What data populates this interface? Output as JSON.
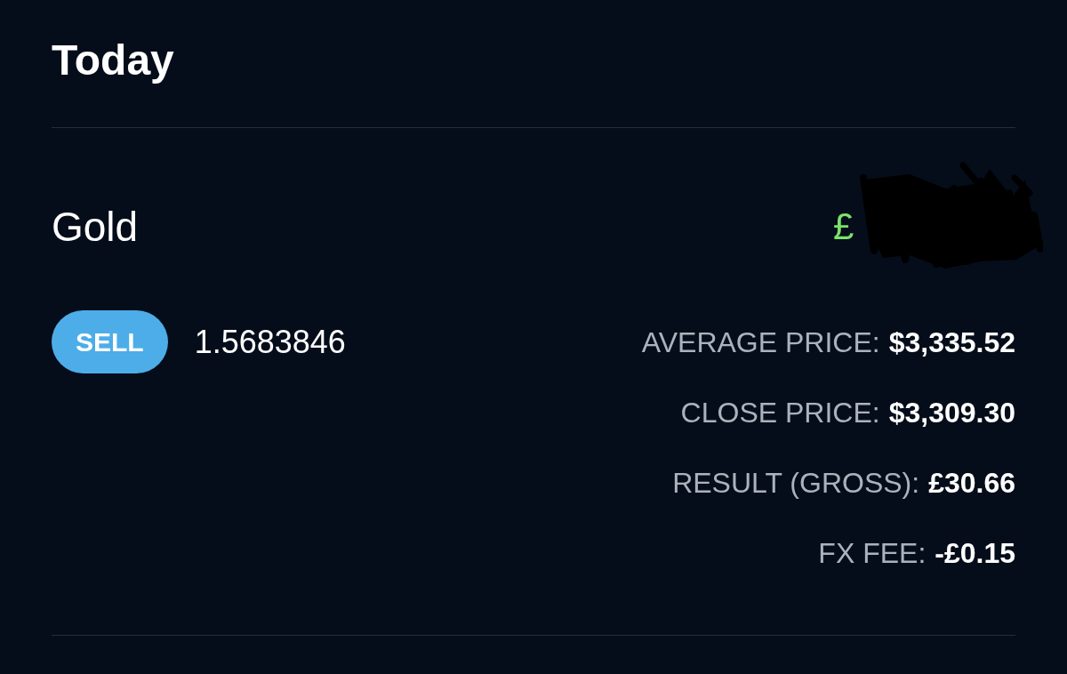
{
  "header": {
    "title": "Today"
  },
  "trade": {
    "instrument": "Gold",
    "amount": "£",
    "amount_positive": true,
    "amount_redacted": true,
    "side": {
      "label": "SELL",
      "kind": "sell"
    },
    "quantity": "1.5683846",
    "details": [
      {
        "label": "AVERAGE PRICE:",
        "value": "$3,335.52"
      },
      {
        "label": "CLOSE PRICE:",
        "value": "$3,309.30"
      },
      {
        "label": "RESULT (GROSS):",
        "value": "£30.66"
      },
      {
        "label": "FX FEE:",
        "value": "-£0.15"
      }
    ]
  }
}
